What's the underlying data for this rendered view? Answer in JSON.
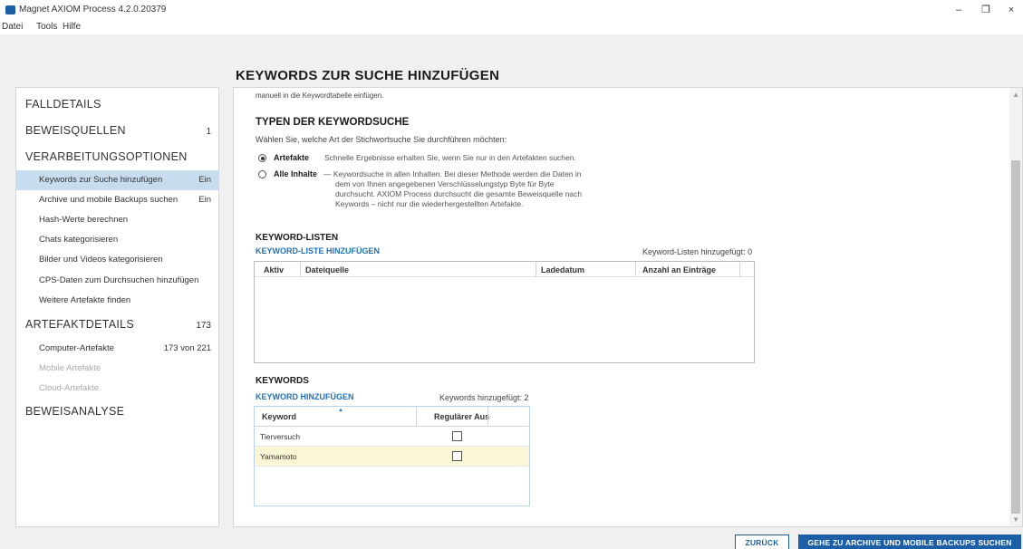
{
  "window": {
    "title": "Magnet AXIOM Process 4.2.0.20379",
    "controls": [
      "–",
      "❐",
      "×"
    ]
  },
  "menu": [
    "Datei",
    "Tools",
    "Hilfe"
  ],
  "page_title": "KEYWORDS ZUR SUCHE HINZUFÜGEN",
  "sidebar": {
    "falldetails": "FALLDETAILS",
    "beweisquellen": "BEWEISQUELLEN",
    "beweisquellen_count": "1",
    "verarbeitungsoptionen": "VERARBEITUNGSOPTIONEN",
    "items": [
      {
        "label": "Keywords zur Suche hinzufügen",
        "value": "Ein"
      },
      {
        "label": "Archive und mobile Backups suchen",
        "value": "Ein"
      },
      {
        "label": "Hash-Werte berechnen",
        "value": ""
      },
      {
        "label": "Chats kategorisieren",
        "value": ""
      },
      {
        "label": "Bilder und Videos kategorisieren",
        "value": ""
      },
      {
        "label": "CPS-Daten zum Durchsuchen hinzufügen",
        "value": ""
      },
      {
        "label": "Weitere Artefakte finden",
        "value": ""
      }
    ],
    "artefaktdetails": "ARTEFAKTDETAILS",
    "artefaktdetails_count": "173",
    "artefakt_items": [
      {
        "label": "Computer-Artefakte",
        "value": "173 von 221"
      },
      {
        "label": "Mobile Artefakte",
        "value": ""
      },
      {
        "label": "Cloud-Artefakte",
        "value": ""
      }
    ],
    "beweisanalyse": "BEWEISANALYSE"
  },
  "main": {
    "intro_cut": "manuell in die Keywordtabelle einfügen.",
    "typen_heading": "TYPEN DER KEYWORDSUCHE",
    "typen_desc": "Wählen Sie, welche Art der Stichwortsuche Sie durchführen möchten:",
    "option1_label": "Artefakte",
    "option1_desc": "Schnelle Ergebnisse erhalten Sie, wenn Sie nur in den Artefakten suchen.",
    "option2_label": "Alle Inhalte",
    "option2_desc_line1": "— Keywordsuche in allen Inhalten. Bei dieser Methode werden die Daten in",
    "option2_desc_line2": "dem von Ihnen angegebenen Verschlüsselungstyp Byte für Byte",
    "option2_desc_line3": "durchsucht. AXIOM Process durchsucht die gesamte Beweisquelle nach",
    "option2_desc_line4": "Keywords – nicht nur die wiederhergestellten Artefakte.",
    "keyword_lists_heading": "KEYWORD-LISTEN",
    "keyword_lists_add": "KEYWORD-LISTE HINZUFÜGEN",
    "keyword_lists_count": "Keyword-Listen hinzugefügt: 0",
    "keyword_lists_columns": [
      "Aktiv",
      "Dateiquelle",
      "Ladedatum",
      "Anzahl an Einträge"
    ],
    "keywords_heading": "KEYWORDS",
    "keywords_add": "KEYWORD HINZUFÜGEN",
    "keywords_count": "Keywords hinzugefügt: 2",
    "keywords_columns": [
      "Keyword",
      "Regulärer Aus"
    ],
    "keywords_rows": [
      {
        "keyword": "Tierversuch"
      },
      {
        "keyword": "Yamamoto"
      }
    ]
  },
  "buttons": {
    "back": "ZURÜCK",
    "next": "GEHE ZU ARCHIVE UND MOBILE BACKUPS SUCHEN"
  }
}
